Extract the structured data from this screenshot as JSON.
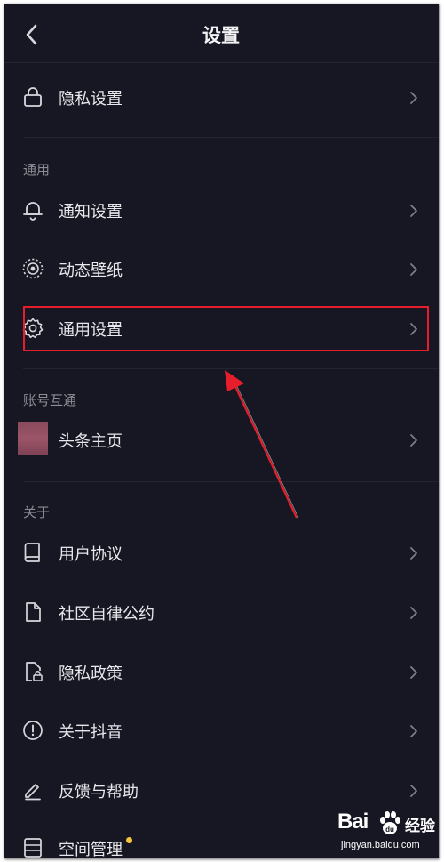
{
  "header": {
    "title": "设置",
    "back_icon": "chevron-left-icon"
  },
  "rows": {
    "privacy_settings": {
      "label": "隐私设置",
      "icon": "lock-icon"
    },
    "notification_settings": {
      "label": "通知设置",
      "icon": "bell-icon"
    },
    "live_wallpaper": {
      "label": "动态壁纸",
      "icon": "wallpaper-icon"
    },
    "general_settings": {
      "label": "通用设置",
      "icon": "gear-icon"
    },
    "toutiao_home": {
      "label": "头条主页",
      "icon": "avatar-thumbnail"
    },
    "user_agreement": {
      "label": "用户协议",
      "icon": "book-icon"
    },
    "community_rules": {
      "label": "社区自律公约",
      "icon": "document-icon"
    },
    "privacy_policy": {
      "label": "隐私政策",
      "icon": "document-lock-icon"
    },
    "about_douyin": {
      "label": "关于抖音",
      "icon": "info-circle-icon"
    },
    "feedback_help": {
      "label": "反馈与帮助",
      "icon": "pencil-icon"
    },
    "storage_management": {
      "label": "空间管理",
      "icon": "storage-icon",
      "has_notification_dot": true
    }
  },
  "sections": {
    "general": "通用",
    "account_link": "账号互通",
    "about": "关于"
  },
  "colors": {
    "background": "#161722",
    "text": "#e8e8ec",
    "section_text": "#8d8e95",
    "highlight_box": "#e61e2b",
    "arrow": "#e61e2b",
    "notification_dot": "#f6c33a"
  },
  "watermark": {
    "brand": "Bai",
    "brand_suffix": "经验",
    "url": "jingyan.baidu.com"
  }
}
